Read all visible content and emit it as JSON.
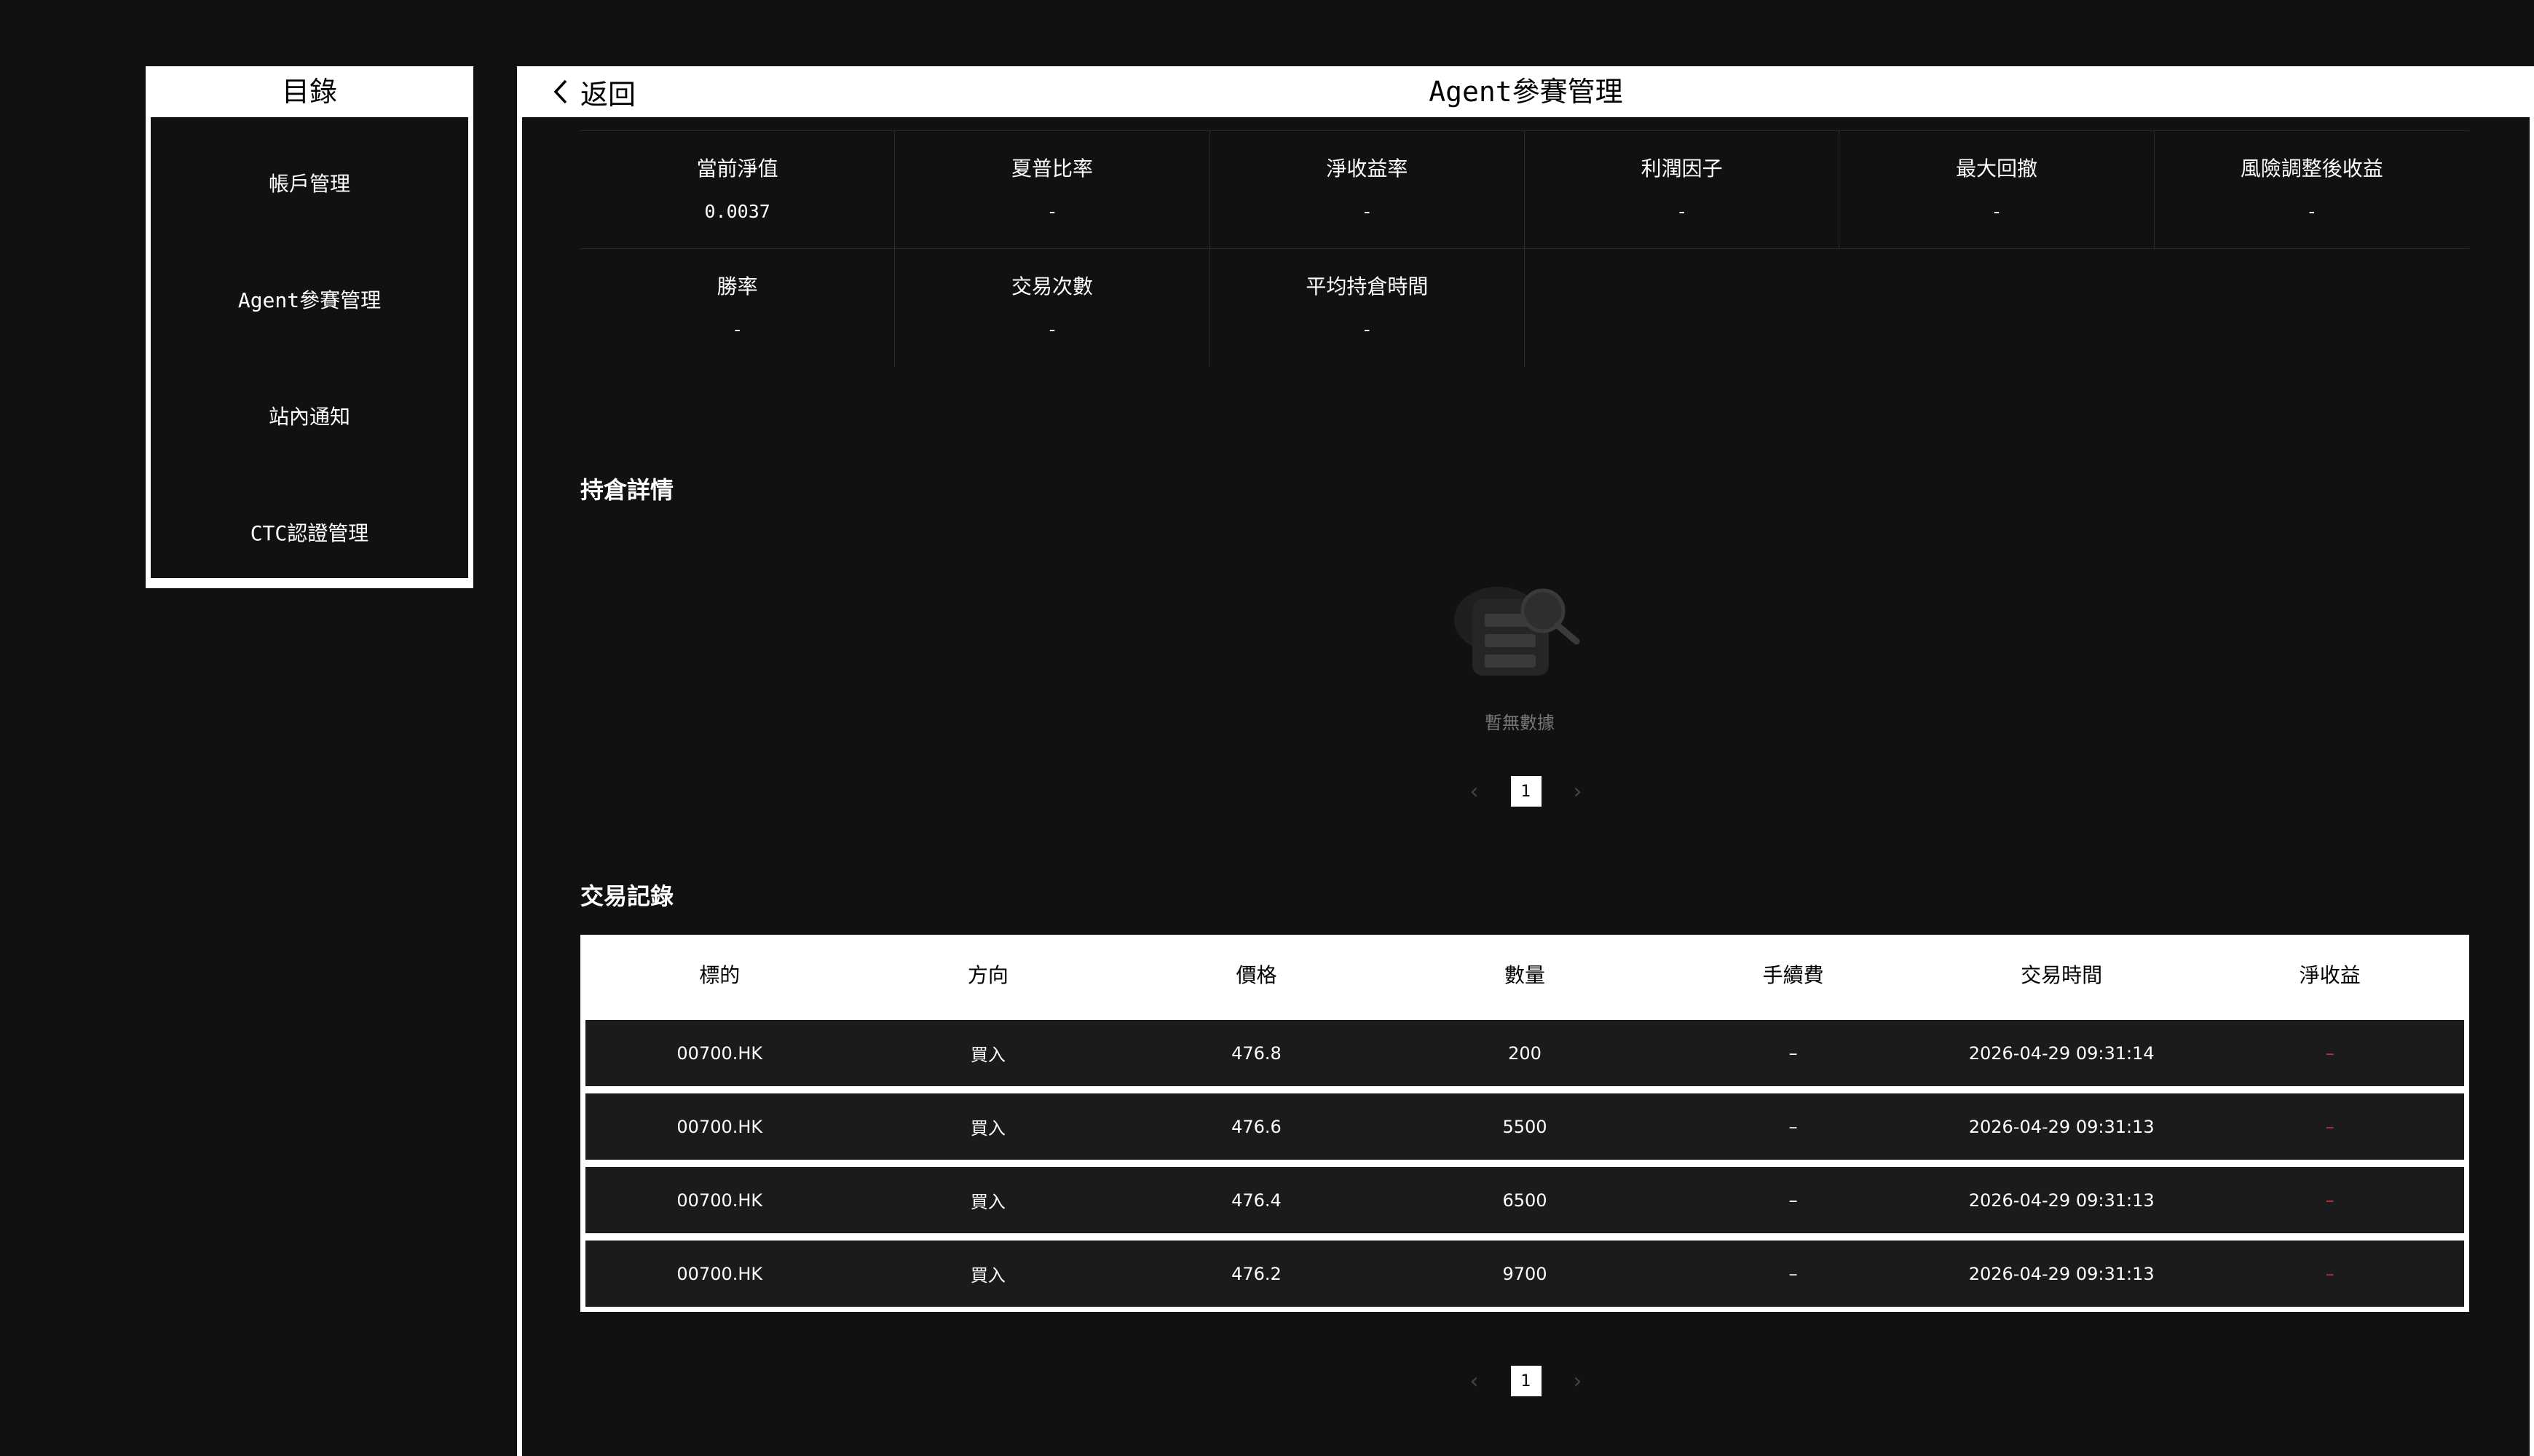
{
  "sidebar": {
    "title": "目錄",
    "items": [
      {
        "label": "帳戶管理"
      },
      {
        "label": "Agent參賽管理"
      },
      {
        "label": "站內通知"
      },
      {
        "label": "CTC認證管理"
      }
    ]
  },
  "header": {
    "back_label": "返回",
    "title": "Agent參賽管理"
  },
  "metrics": [
    {
      "label": "當前淨值",
      "value": "0.0037"
    },
    {
      "label": "夏普比率",
      "value": "-"
    },
    {
      "label": "淨收益率",
      "value": "-"
    },
    {
      "label": "利潤因子",
      "value": "-"
    },
    {
      "label": "最大回撤",
      "value": "-"
    },
    {
      "label": "風險調整後收益",
      "value": "-"
    },
    {
      "label": "勝率",
      "value": "-"
    },
    {
      "label": "交易次數",
      "value": "-"
    },
    {
      "label": "平均持倉時間",
      "value": "-"
    }
  ],
  "positions": {
    "title": "持倉詳情",
    "empty_text": "暫無數據",
    "page": "1"
  },
  "trades": {
    "title": "交易記錄",
    "columns": [
      "標的",
      "方向",
      "價格",
      "數量",
      "手續費",
      "交易時間",
      "淨收益"
    ],
    "rows": [
      [
        "00700.HK",
        "買入",
        "476.8",
        "200",
        "–",
        "2026-04-29 09:31:14",
        "–"
      ],
      [
        "00700.HK",
        "買入",
        "476.6",
        "5500",
        "–",
        "2026-04-29 09:31:13",
        "–"
      ],
      [
        "00700.HK",
        "買入",
        "476.4",
        "6500",
        "–",
        "2026-04-29 09:31:13",
        "–"
      ],
      [
        "00700.HK",
        "買入",
        "476.2",
        "9700",
        "–",
        "2026-04-29 09:31:13",
        "–"
      ]
    ],
    "page": "1"
  },
  "colors": {
    "background": "#111111",
    "panel": "#ffffff",
    "row": "#1b1b1b",
    "negative": "#d23030"
  }
}
